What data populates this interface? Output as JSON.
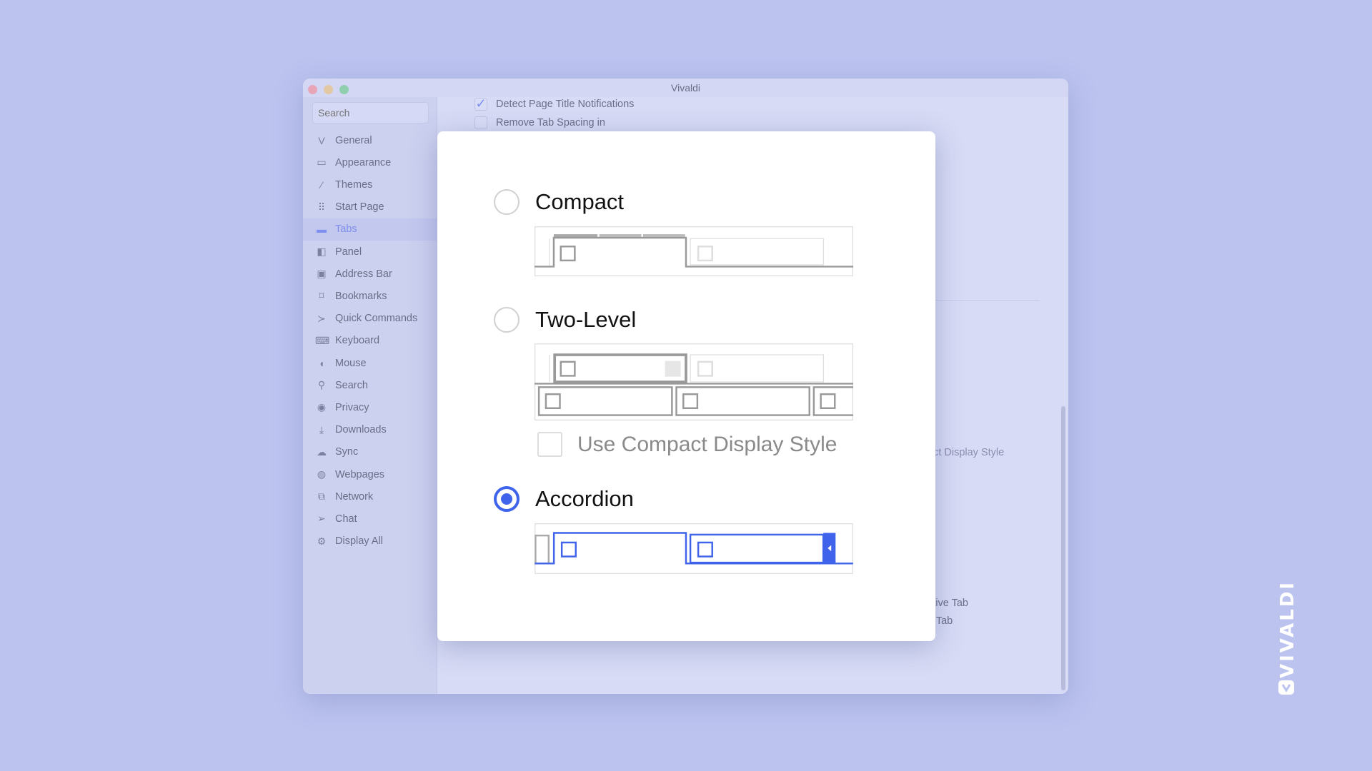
{
  "window": {
    "title": "Vivaldi"
  },
  "sidebar": {
    "search_placeholder": "Search",
    "items": [
      {
        "label": "General",
        "icon": "vivaldi-v-icon",
        "glyph": "V"
      },
      {
        "label": "Appearance",
        "icon": "window-icon",
        "glyph": "▭"
      },
      {
        "label": "Themes",
        "icon": "brush-icon",
        "glyph": "⁄"
      },
      {
        "label": "Start Page",
        "icon": "grid-icon",
        "glyph": "⠿"
      },
      {
        "label": "Tabs",
        "icon": "tabs-icon",
        "glyph": "▬",
        "active": true
      },
      {
        "label": "Panel",
        "icon": "panel-icon",
        "glyph": "◧"
      },
      {
        "label": "Address Bar",
        "icon": "address-bar-icon",
        "glyph": "▣"
      },
      {
        "label": "Bookmarks",
        "icon": "bookmark-icon",
        "glyph": "⌑"
      },
      {
        "label": "Quick Commands",
        "icon": "quick-commands-icon",
        "glyph": "≻"
      },
      {
        "label": "Keyboard",
        "icon": "keyboard-icon",
        "glyph": "⌨"
      },
      {
        "label": "Mouse",
        "icon": "mouse-icon",
        "glyph": "◖"
      },
      {
        "label": "Search",
        "icon": "search-icon",
        "glyph": "⚲"
      },
      {
        "label": "Privacy",
        "icon": "eye-icon",
        "glyph": "◉"
      },
      {
        "label": "Downloads",
        "icon": "download-icon",
        "glyph": "⤓"
      },
      {
        "label": "Sync",
        "icon": "cloud-icon",
        "glyph": "☁"
      },
      {
        "label": "Webpages",
        "icon": "globe-icon",
        "glyph": "◍"
      },
      {
        "label": "Network",
        "icon": "network-icon",
        "glyph": "⧉"
      },
      {
        "label": "Chat",
        "icon": "send-icon",
        "glyph": "➢"
      },
      {
        "label": "Display All",
        "icon": "gear-icon",
        "glyph": "⚙"
      }
    ]
  },
  "content": {
    "detect_label": "Detect Page Title Notifications",
    "detect_checked": true,
    "remove_spacing_label": "Remove Tab Spacing in",
    "remove_spacing_checked": false,
    "bg_compact_style": "act Display Style",
    "bg_active_tab": "ctive Tab",
    "bg_tab": "e Tab"
  },
  "modal": {
    "options": [
      {
        "label": "Compact",
        "selected": false
      },
      {
        "label": "Two-Level",
        "selected": false
      },
      {
        "label": "Accordion",
        "selected": true
      }
    ],
    "compact_display_label": "Use Compact Display Style",
    "compact_display_checked": false
  },
  "colors": {
    "accent": "#3f63ea",
    "background": "#bcc3ef"
  },
  "brand": "VIVALDI"
}
